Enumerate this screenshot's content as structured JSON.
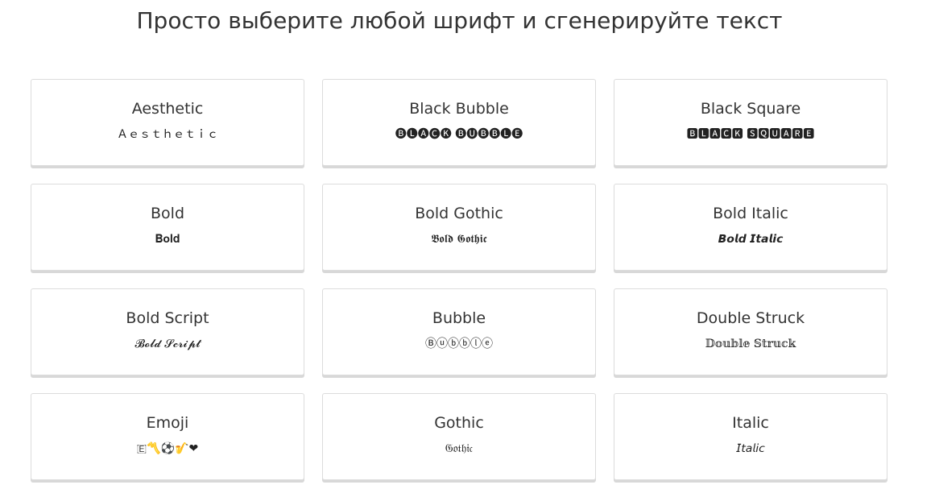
{
  "heading": "Просто выберите любой шрифт и сгенерируйте текст",
  "fonts": [
    {
      "title": "Aesthetic",
      "sample": "Ａｅｓｔｈｅｔｉｃ"
    },
    {
      "title": "Black Bubble",
      "sample": "🅑🅛🅐🅒🅚 🅑🅤🅑🅑🅛🅔"
    },
    {
      "title": "Black Square",
      "sample": "🅱🅻🅰🅲🅺 🆂🆀🆄🅰🆁🅴"
    },
    {
      "title": "Bold",
      "sample": "𝐁𝐨𝐥𝐝"
    },
    {
      "title": "Bold Gothic",
      "sample": "𝕭𝖔𝖑𝖉 𝕲𝖔𝖙𝖍𝖎𝖈"
    },
    {
      "title": "Bold Italic",
      "sample": "𝘽𝙤𝙡𝙙 𝙄𝙩𝙖𝙡𝙞𝙘"
    },
    {
      "title": "Bold Script",
      "sample": "𝓑𝓸𝓵𝓭 𝓢𝓬𝓻𝓲𝓹𝓽"
    },
    {
      "title": "Bubble",
      "sample": "Ⓑⓤⓑⓑⓛⓔ"
    },
    {
      "title": "Double Struck",
      "sample": "𝔻𝕠𝕦𝕓𝕝𝕖 𝕊𝕥𝕣𝕦𝕔𝕜"
    },
    {
      "title": "Emoji",
      "sample": "🇪〽️⚽🎷❤"
    },
    {
      "title": "Gothic",
      "sample": "𝔊𝔬𝔱𝔥𝔦𝔠"
    },
    {
      "title": "Italic",
      "sample": "𝘐𝘵𝘢𝘭𝘪𝘤"
    }
  ]
}
